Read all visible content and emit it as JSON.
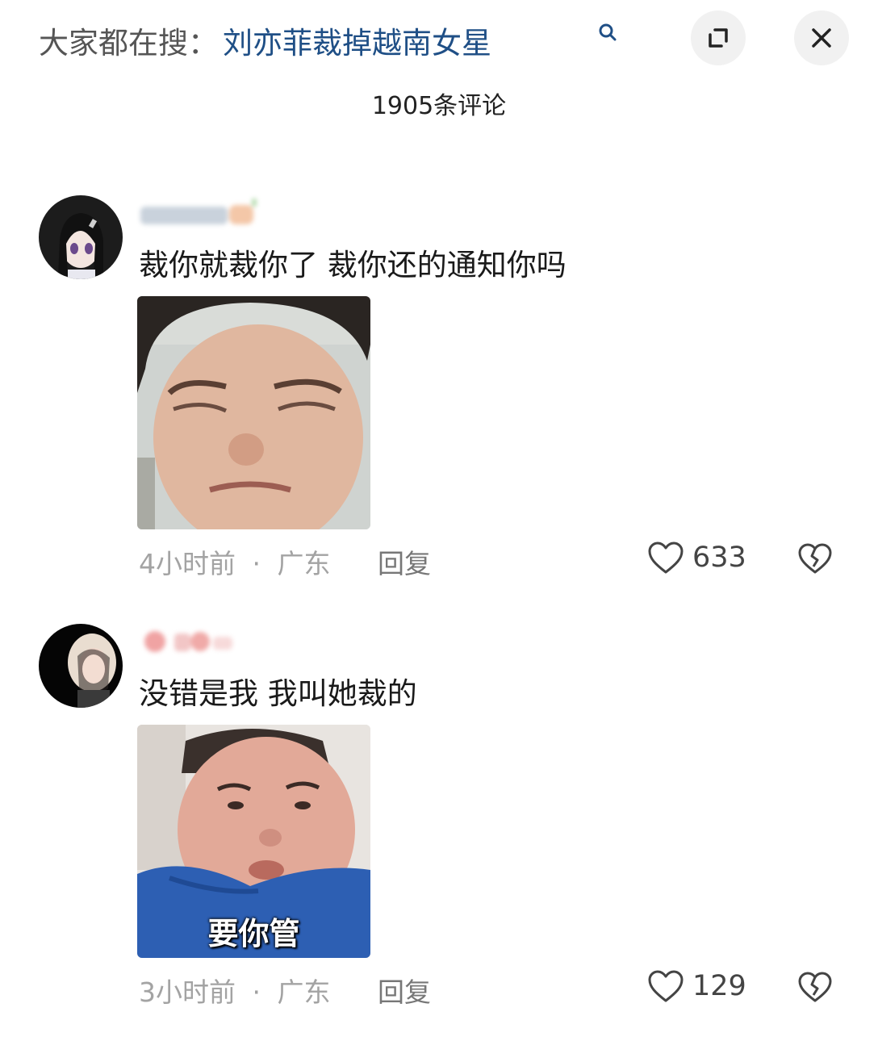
{
  "header": {
    "search_prefix": "大家都在搜：",
    "search_query": "刘亦菲裁掉越南女星",
    "comment_count": "1905条评论"
  },
  "icons": {
    "search": "search-icon",
    "expand": "expand-icon",
    "close": "close-icon",
    "like": "heart-outline-icon",
    "dislike": "broken-heart-icon"
  },
  "comments": [
    {
      "text": "裁你就裁你了 裁你还的通知你吗",
      "sticker_caption": "",
      "time": "4小时前",
      "separator": "·",
      "region": "广东",
      "reply_label": "回复",
      "likes": "633"
    },
    {
      "text": "没错是我 我叫她裁的",
      "sticker_caption": "要你管",
      "time": "3小时前",
      "separator": "·",
      "region": "广东",
      "reply_label": "回复",
      "likes": "129"
    }
  ]
}
